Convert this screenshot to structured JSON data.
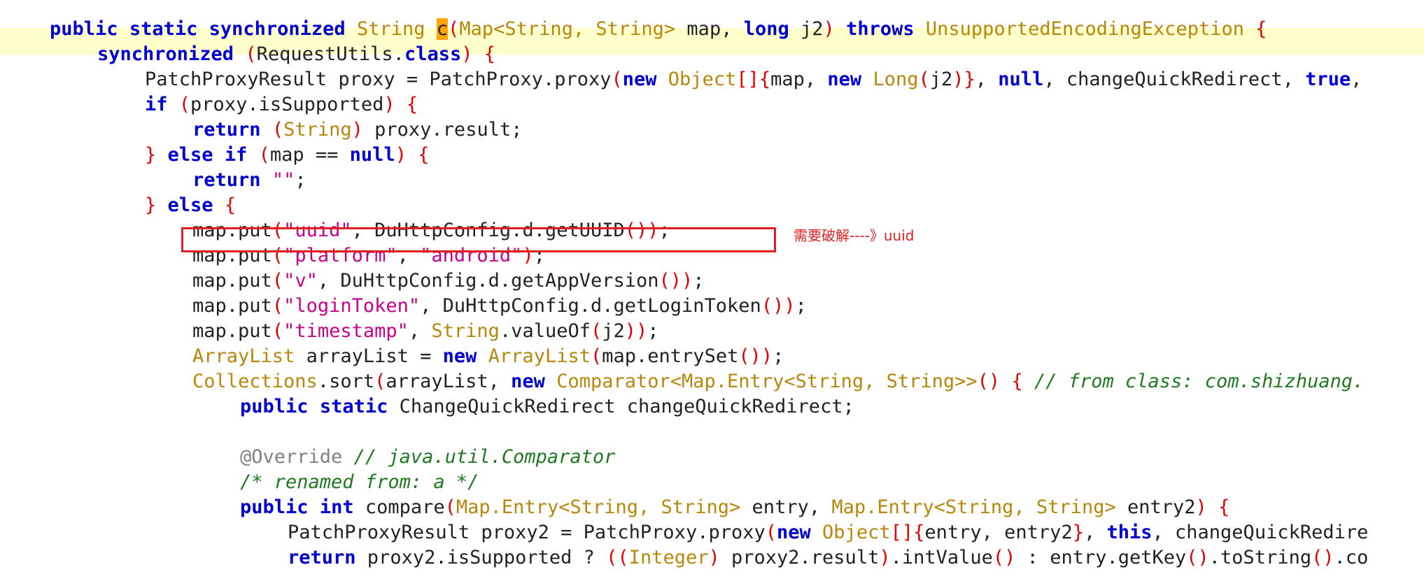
{
  "code": {
    "lines": [
      {
        "indent": 1,
        "tokens": [
          [
            "kw",
            "public"
          ],
          [
            "t",
            " "
          ],
          [
            "kw",
            "static"
          ],
          [
            "t",
            " "
          ],
          [
            "kw",
            "synchronized"
          ],
          [
            "t",
            " "
          ],
          [
            "ty",
            "String"
          ],
          [
            "t",
            " "
          ],
          [
            "caret",
            "c"
          ],
          [
            "pu",
            "("
          ],
          [
            "ty",
            "Map<String, String>"
          ],
          [
            "t",
            " map, "
          ],
          [
            "kw",
            "long"
          ],
          [
            "t",
            " j2"
          ],
          [
            "pu",
            ")"
          ],
          [
            "t",
            " "
          ],
          [
            "kw",
            "throws"
          ],
          [
            "t",
            " "
          ],
          [
            "ty",
            "UnsupportedEncodingException"
          ],
          [
            "t",
            " "
          ],
          [
            "pu",
            "{"
          ]
        ]
      },
      {
        "indent": 2,
        "tokens": [
          [
            "kw",
            "synchronized"
          ],
          [
            "t",
            " "
          ],
          [
            "pu",
            "("
          ],
          [
            "t",
            "RequestUtils."
          ],
          [
            "kw",
            "class"
          ],
          [
            "pu",
            ")"
          ],
          [
            "t",
            " "
          ],
          [
            "pu",
            "{"
          ]
        ]
      },
      {
        "indent": 3,
        "tokens": [
          [
            "t",
            "PatchProxyResult proxy = PatchProxy.proxy"
          ],
          [
            "pu",
            "("
          ],
          [
            "kw",
            "new"
          ],
          [
            "t",
            " "
          ],
          [
            "ty",
            "Object"
          ],
          [
            "pu",
            "[]{"
          ],
          [
            "t",
            "map, "
          ],
          [
            "kw",
            "new"
          ],
          [
            "t",
            " "
          ],
          [
            "ty",
            "Long"
          ],
          [
            "pu",
            "("
          ],
          [
            "t",
            "j2"
          ],
          [
            "pu",
            ")}"
          ],
          [
            "t",
            ", "
          ],
          [
            "kw",
            "null"
          ],
          [
            "t",
            ", changeQuickRedirect, "
          ],
          [
            "kw",
            "true"
          ],
          [
            "t",
            ","
          ]
        ]
      },
      {
        "indent": 3,
        "tokens": [
          [
            "kw",
            "if"
          ],
          [
            "t",
            " "
          ],
          [
            "pu",
            "("
          ],
          [
            "t",
            "proxy.isSupported"
          ],
          [
            "pu",
            ")"
          ],
          [
            "t",
            " "
          ],
          [
            "pu",
            "{"
          ]
        ]
      },
      {
        "indent": 4,
        "tokens": [
          [
            "kw",
            "return"
          ],
          [
            "t",
            " "
          ],
          [
            "pu",
            "("
          ],
          [
            "ty",
            "String"
          ],
          [
            "pu",
            ")"
          ],
          [
            "t",
            " proxy.result;"
          ]
        ]
      },
      {
        "indent": 3,
        "tokens": [
          [
            "pu",
            "}"
          ],
          [
            "t",
            " "
          ],
          [
            "kw",
            "else"
          ],
          [
            "t",
            " "
          ],
          [
            "kw",
            "if"
          ],
          [
            "t",
            " "
          ],
          [
            "pu",
            "("
          ],
          [
            "t",
            "map == "
          ],
          [
            "kw",
            "null"
          ],
          [
            "pu",
            ")"
          ],
          [
            "t",
            " "
          ],
          [
            "pu",
            "{"
          ]
        ]
      },
      {
        "indent": 4,
        "tokens": [
          [
            "kw",
            "return"
          ],
          [
            "t",
            " "
          ],
          [
            "st",
            "\"\""
          ],
          [
            "t",
            ";"
          ]
        ]
      },
      {
        "indent": 3,
        "tokens": [
          [
            "pu",
            "}"
          ],
          [
            "t",
            " "
          ],
          [
            "kw",
            "else"
          ],
          [
            "t",
            " "
          ],
          [
            "pu",
            "{"
          ]
        ]
      },
      {
        "indent": 4,
        "tokens": [
          [
            "t",
            "map.put"
          ],
          [
            "pu",
            "("
          ],
          [
            "st",
            "\"uuid\""
          ],
          [
            "t",
            ", DuHttpConfig.d.getUUID"
          ],
          [
            "pu",
            "())"
          ],
          [
            "t",
            ";"
          ]
        ]
      },
      {
        "indent": 4,
        "tokens": [
          [
            "t",
            "map.put"
          ],
          [
            "pu",
            "("
          ],
          [
            "st",
            "\"platform\""
          ],
          [
            "t",
            ", "
          ],
          [
            "st",
            "\"android\""
          ],
          [
            "pu",
            ")"
          ],
          [
            "t",
            ";"
          ]
        ]
      },
      {
        "indent": 4,
        "tokens": [
          [
            "t",
            "map.put"
          ],
          [
            "pu",
            "("
          ],
          [
            "st",
            "\"v\""
          ],
          [
            "t",
            ", DuHttpConfig.d.getAppVersion"
          ],
          [
            "pu",
            "())"
          ],
          [
            "t",
            ";"
          ]
        ]
      },
      {
        "indent": 4,
        "tokens": [
          [
            "t",
            "map.put"
          ],
          [
            "pu",
            "("
          ],
          [
            "st",
            "\"loginToken\""
          ],
          [
            "t",
            ", DuHttpConfig.d.getLoginToken"
          ],
          [
            "pu",
            "())"
          ],
          [
            "t",
            ";"
          ]
        ]
      },
      {
        "indent": 4,
        "tokens": [
          [
            "t",
            "map.put"
          ],
          [
            "pu",
            "("
          ],
          [
            "st",
            "\"timestamp\""
          ],
          [
            "t",
            ", "
          ],
          [
            "ty",
            "String"
          ],
          [
            "t",
            ".valueOf"
          ],
          [
            "pu",
            "("
          ],
          [
            "t",
            "j2"
          ],
          [
            "pu",
            "))"
          ],
          [
            "t",
            ";"
          ]
        ]
      },
      {
        "indent": 4,
        "tokens": [
          [
            "ty",
            "ArrayList"
          ],
          [
            "t",
            " arrayList = "
          ],
          [
            "kw",
            "new"
          ],
          [
            "t",
            " "
          ],
          [
            "ty",
            "ArrayList"
          ],
          [
            "pu",
            "("
          ],
          [
            "t",
            "map.entrySet"
          ],
          [
            "pu",
            "())"
          ],
          [
            "t",
            ";"
          ]
        ]
      },
      {
        "indent": 4,
        "tokens": [
          [
            "ty",
            "Collections"
          ],
          [
            "t",
            ".sort"
          ],
          [
            "pu",
            "("
          ],
          [
            "t",
            "arrayList, "
          ],
          [
            "kw",
            "new"
          ],
          [
            "t",
            " "
          ],
          [
            "ty",
            "Comparator<Map.Entry<String, String>>"
          ],
          [
            "pu",
            "()"
          ],
          [
            "t",
            " "
          ],
          [
            "pu",
            "{"
          ],
          [
            "t",
            " "
          ],
          [
            "cm",
            "// from class: com.shizhuang."
          ]
        ]
      },
      {
        "indent": 5,
        "tokens": [
          [
            "kw",
            "public"
          ],
          [
            "t",
            " "
          ],
          [
            "kw",
            "static"
          ],
          [
            "t",
            " ChangeQuickRedirect changeQuickRedirect;"
          ]
        ]
      },
      {
        "indent": 5,
        "tokens": []
      },
      {
        "indent": 5,
        "tokens": [
          [
            "an",
            "@Override"
          ],
          [
            "t",
            " "
          ],
          [
            "cm",
            "// java.util.Comparator"
          ]
        ]
      },
      {
        "indent": 5,
        "tokens": [
          [
            "cm",
            "/* renamed from: a */"
          ]
        ]
      },
      {
        "indent": 5,
        "tokens": [
          [
            "kw",
            "public"
          ],
          [
            "t",
            " "
          ],
          [
            "kw",
            "int"
          ],
          [
            "t",
            " compare"
          ],
          [
            "pu",
            "("
          ],
          [
            "ty",
            "Map.Entry<String, String>"
          ],
          [
            "t",
            " entry, "
          ],
          [
            "ty",
            "Map.Entry<String, String>"
          ],
          [
            "t",
            " entry2"
          ],
          [
            "pu",
            ")"
          ],
          [
            "t",
            " "
          ],
          [
            "pu",
            "{"
          ]
        ]
      },
      {
        "indent": 6,
        "tokens": [
          [
            "t",
            "PatchProxyResult proxy2 = PatchProxy.proxy"
          ],
          [
            "pu",
            "("
          ],
          [
            "kw",
            "new"
          ],
          [
            "t",
            " "
          ],
          [
            "ty",
            "Object"
          ],
          [
            "pu",
            "[]{"
          ],
          [
            "t",
            "entry, entry2"
          ],
          [
            "pu",
            "}"
          ],
          [
            "t",
            ", "
          ],
          [
            "kw",
            "this"
          ],
          [
            "t",
            ", changeQuickRedire"
          ]
        ]
      },
      {
        "indent": 6,
        "tokens": [
          [
            "kw",
            "return"
          ],
          [
            "t",
            " proxy2.isSupported ? "
          ],
          [
            "pu",
            "(("
          ],
          [
            "ty",
            "Integer"
          ],
          [
            "pu",
            ")"
          ],
          [
            "t",
            " proxy2.result"
          ],
          [
            "pu",
            ")"
          ],
          [
            "t",
            ".intValue"
          ],
          [
            "pu",
            "()"
          ],
          [
            "t",
            " : entry.getKey"
          ],
          [
            "pu",
            "()"
          ],
          [
            "t",
            ".toString"
          ],
          [
            "pu",
            "()"
          ],
          [
            "t",
            ".co"
          ]
        ]
      }
    ]
  },
  "annotation": {
    "note": "需要破解----》uuid"
  },
  "colors": {
    "keyword": "#0000d0",
    "type": "#b8860b",
    "string": "#c8008c",
    "punctuation": "#e00000",
    "comment": "#1f7a1f",
    "annotation": "#808080",
    "line_highlight": "#ffffcc",
    "caret_highlight": "#ffa500",
    "annotation_box": "#e02020"
  }
}
